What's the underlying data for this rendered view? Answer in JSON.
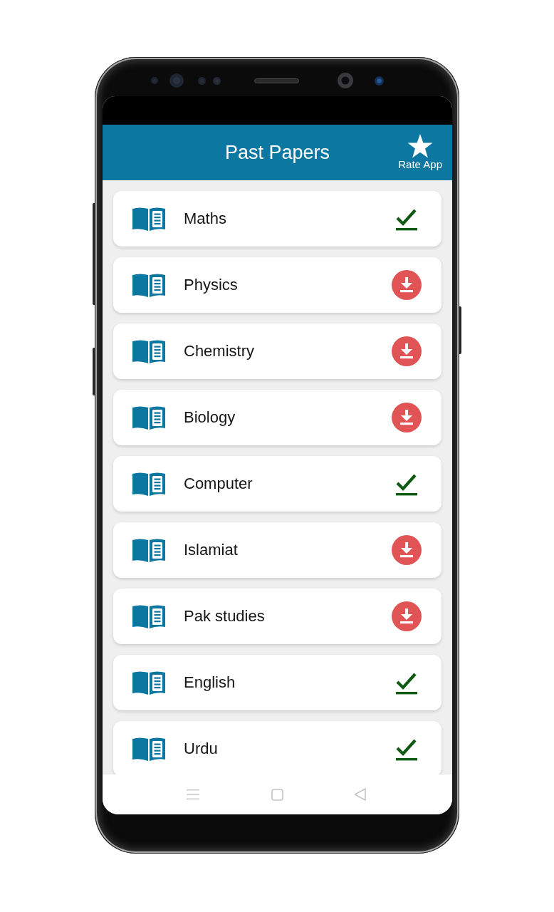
{
  "app_bar": {
    "title": "Past Papers",
    "rate_label": "Rate App"
  },
  "subjects": [
    {
      "name": "Maths",
      "downloaded": true
    },
    {
      "name": "Physics",
      "downloaded": false
    },
    {
      "name": "Chemistry",
      "downloaded": false
    },
    {
      "name": "Biology",
      "downloaded": false
    },
    {
      "name": "Computer",
      "downloaded": true
    },
    {
      "name": "Islamiat",
      "downloaded": false
    },
    {
      "name": "Pak studies",
      "downloaded": false
    },
    {
      "name": "English",
      "downloaded": true
    },
    {
      "name": "Urdu",
      "downloaded": true
    }
  ]
}
